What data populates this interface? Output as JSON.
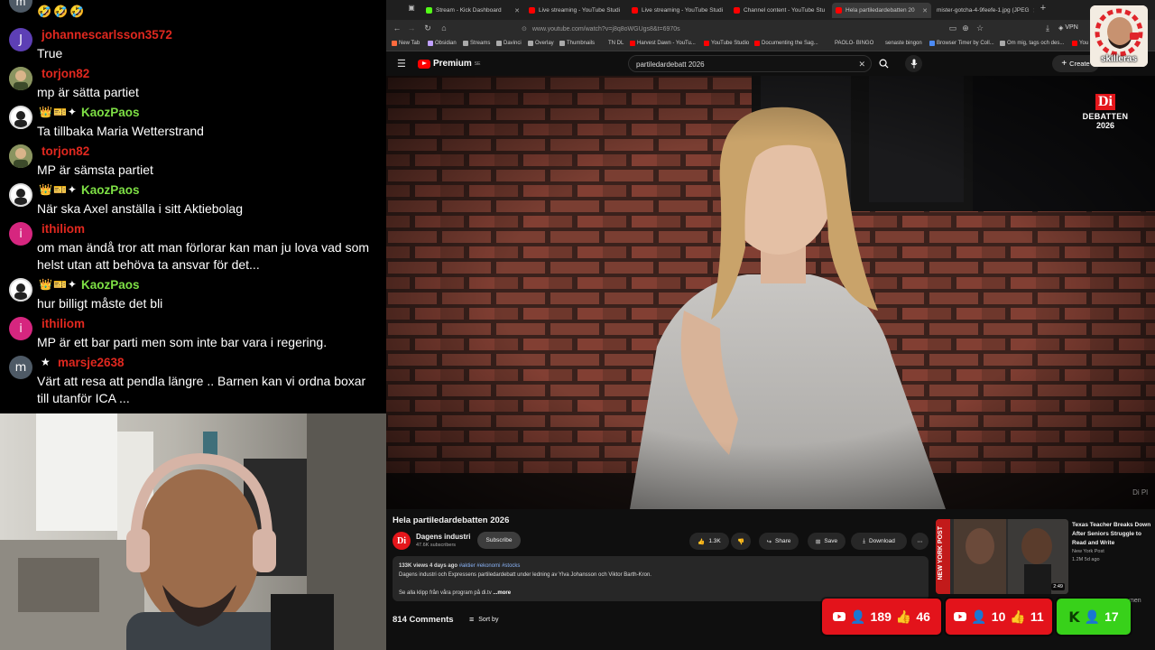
{
  "chat": {
    "top_emojis": "🤣🤣🤣",
    "top_avatar": "m",
    "messages": [
      {
        "avatar": "J",
        "user": "johannescarlsson3572",
        "text": "True",
        "badges": ""
      },
      {
        "avatar": "",
        "user": "torjon82",
        "text": "mp är sätta partiet",
        "badges": ""
      },
      {
        "avatar": "",
        "user": "KaozPaos",
        "text": "Ta tillbaka Maria Wetterstrand",
        "badges": "👑🎫✦"
      },
      {
        "avatar": "",
        "user": "torjon82",
        "text": "MP är sämsta partiet",
        "badges": ""
      },
      {
        "avatar": "",
        "user": "KaozPaos",
        "text": "När ska Axel anställa i sitt Aktiebolag",
        "badges": "👑🎫✦"
      },
      {
        "avatar": "i",
        "user": "ithiliom",
        "text": "om man ändå tror att man förlorar kan man ju lova vad som helst utan att behöva ta ansvar för det...",
        "badges": ""
      },
      {
        "avatar": "",
        "user": "KaozPaos",
        "text": "hur billigt måste det bli",
        "badges": "👑🎫✦"
      },
      {
        "avatar": "i",
        "user": "ithiliom",
        "text": "MP är ett bar parti men som inte bar vara i regering.",
        "badges": ""
      },
      {
        "avatar": "m",
        "user": "marsje2638",
        "text": "Värt att resa att pendla längre .. Barnen kan vi ordna boxar till utanför ICA ...",
        "badges": "★"
      }
    ]
  },
  "browser": {
    "tabs": [
      {
        "label": "Stream - Kick Dashboard",
        "color": "#53fc18"
      },
      {
        "label": "Live streaming - YouTube Studi",
        "color": "#ff0000"
      },
      {
        "label": "Live streaming - YouTube Studi",
        "color": "#ff0000"
      },
      {
        "label": "Channel content - YouTube Stu",
        "color": "#ff0000"
      },
      {
        "label": "Hela partiledardebatten 20",
        "color": "#ff0000"
      },
      {
        "label": "mister-gotcha-4-9feefe-1.jpg (JPEG",
        "color": "#888888"
      }
    ],
    "url": "www.youtube.com/watch?v=j8q8oWGUgs8&t=6970s",
    "vpn": "VPN",
    "bookmarks": [
      "New Tab",
      "Obsidian",
      "Streams",
      "Davinci",
      "Overlay",
      "Thumbnails",
      "TN DL",
      "Harvest Dawn - YouTu...",
      "YouTube Studio",
      "Documenting the Sag...",
      "PAOLO- BINGO",
      "senaste bingon",
      "Browser Timer by Coll...",
      "Om mig, tags och des...",
      "You"
    ]
  },
  "youtube": {
    "logo": "Premium",
    "logo_sup": "SE",
    "search_value": "partiledardebatt 2026",
    "create": "Create",
    "video_title": "Hela partiledardebatten 2026",
    "channel": "Dagens industri",
    "subscribers": "47.6K subscribers",
    "subscribe": "Subscribe",
    "likes": "1.3K",
    "share": "Share",
    "save": "Save",
    "download": "Download",
    "views": "133K views",
    "posted": "4 days ago",
    "tags": "#aktier #ekonomi #stocks",
    "description": "Dagens industri och Expressens partiledardebatt under ledning av Ylva Johansson och Viktor Barth-Kron.",
    "desc_line2": "Se alla klipp från våra program på di.tv",
    "more": "...more",
    "comments": "814 Comments",
    "sort": "Sort by",
    "overlay_di": "Di",
    "overlay_debatten": "DEBATTEN",
    "overlay_year": "2026",
    "watermark": "Di Pl",
    "recommended": {
      "title": "Texas Teacher Breaks Down After Seniors Struggle to Read and Write",
      "source": "New York Post",
      "stats": "1.2M  5d ago",
      "duration": "2:49",
      "thumb_text": "NEW YORK POST"
    },
    "rec_extra": "men"
  },
  "profile": {
    "name": "skilleras"
  },
  "widgets": [
    {
      "kind": "youtube",
      "viewers": "189",
      "likes": "46"
    },
    {
      "kind": "youtube",
      "viewers": "10",
      "likes": "11"
    },
    {
      "kind": "kick",
      "viewers": "17"
    }
  ]
}
